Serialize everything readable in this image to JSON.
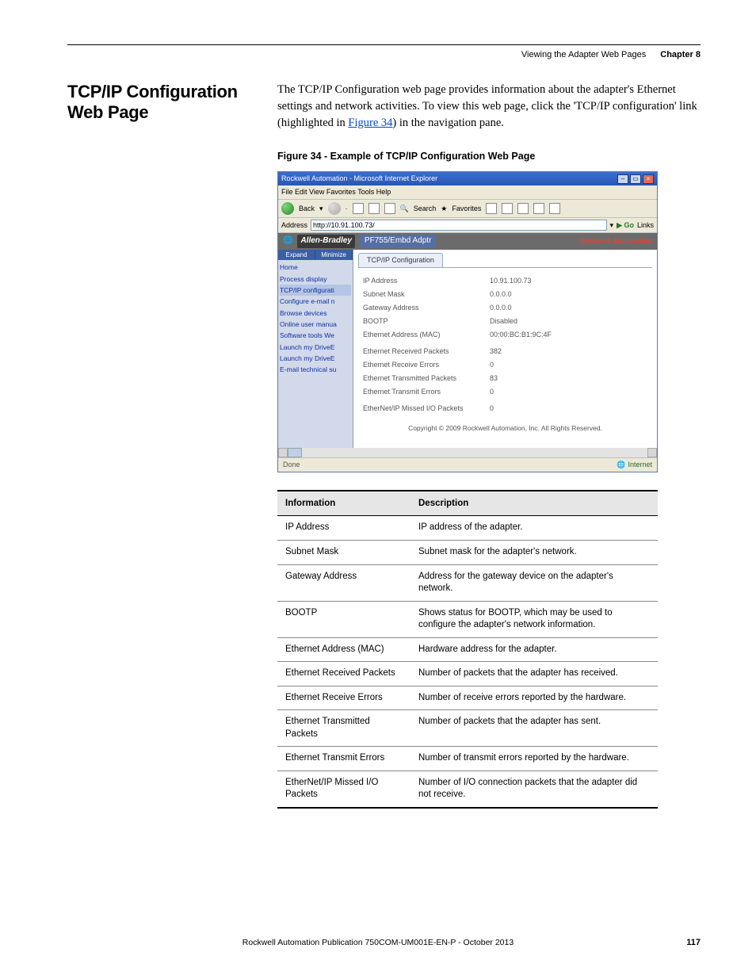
{
  "header": {
    "breadcrumb": "Viewing the Adapter Web Pages",
    "chapter": "Chapter 8"
  },
  "section_title": "TCP/IP Configuration Web Page",
  "intro": {
    "text_before_link": "The TCP/IP Configuration web page provides information about the adapter's Ethernet settings and network activities. To view this web page, click the 'TCP/IP configuration' link (highlighted in ",
    "link_text": "Figure 34",
    "text_after_link": ") in the navigation pane."
  },
  "figure_caption": "Figure 34 - Example of TCP/IP Configuration Web Page",
  "screenshot": {
    "title": "Rockwell Automation - Microsoft Internet Explorer",
    "menus": "File   Edit   View   Favorites   Tools   Help",
    "back_label": "Back",
    "search_label": "Search",
    "favorites_label": "Favorites",
    "address_label": "Address",
    "address_value": "http://10.91.100.73/",
    "go_label": "Go",
    "links_label": "Links",
    "brand": "Allen-Bradley",
    "product": "PF755/Embd Adptr",
    "rockwell": "Rockwell Automation",
    "nav": {
      "expand": "Expand",
      "minimize": "Minimize",
      "items": [
        "Home",
        "Process display",
        "TCP/IP configurati",
        "Configure e-mail n",
        "Browse devices",
        "Online user manua",
        "Software tools We",
        "Launch my DriveE",
        "Launch my DriveE",
        "E-mail technical su"
      ]
    },
    "tab": "TCP/IP Configuration",
    "rows": [
      {
        "k": "IP Address",
        "v": "10.91.100.73"
      },
      {
        "k": "Subnet Mask",
        "v": "0.0.0.0"
      },
      {
        "k": "Gateway Address",
        "v": "0.0.0.0"
      },
      {
        "k": "BOOTP",
        "v": "Disabled"
      },
      {
        "k": "Ethernet Address (MAC)",
        "v": "00:00:BC:B1:9C:4F"
      }
    ],
    "rows2": [
      {
        "k": "Ethernet Received Packets",
        "v": "382"
      },
      {
        "k": "Ethernet Receive Errors",
        "v": "0"
      },
      {
        "k": "Ethernet Transmitted Packets",
        "v": "83"
      },
      {
        "k": "Ethernet Transmit Errors",
        "v": "0"
      }
    ],
    "rows3": [
      {
        "k": "EtherNet/IP Missed I/O Packets",
        "v": "0"
      }
    ],
    "copyright": "Copyright © 2009 Rockwell Automation, Inc. All Rights Reserved.",
    "status_done": "Done",
    "status_zone": "Internet"
  },
  "table": {
    "headers": [
      "Information",
      "Description"
    ],
    "rows": [
      [
        "IP Address",
        "IP address of the adapter."
      ],
      [
        "Subnet Mask",
        "Subnet mask for the adapter's network."
      ],
      [
        "Gateway Address",
        "Address for the gateway device on the adapter's network."
      ],
      [
        "BOOTP",
        "Shows status for BOOTP, which may be used to configure the adapter's network information."
      ],
      [
        "Ethernet Address (MAC)",
        "Hardware address for the adapter."
      ],
      [
        "Ethernet Received Packets",
        "Number of packets that the adapter has received."
      ],
      [
        "Ethernet Receive Errors",
        "Number of receive errors reported by the hardware."
      ],
      [
        "Ethernet Transmitted Packets",
        "Number of packets that the adapter has sent."
      ],
      [
        "Ethernet Transmit Errors",
        "Number of transmit errors reported by the hardware."
      ],
      [
        "EtherNet/IP Missed I/O Packets",
        "Number of I/O connection packets that the adapter did not receive."
      ]
    ]
  },
  "footer": {
    "pub": "Rockwell Automation Publication 750COM-UM001E-EN-P - October 2013",
    "page": "117"
  }
}
